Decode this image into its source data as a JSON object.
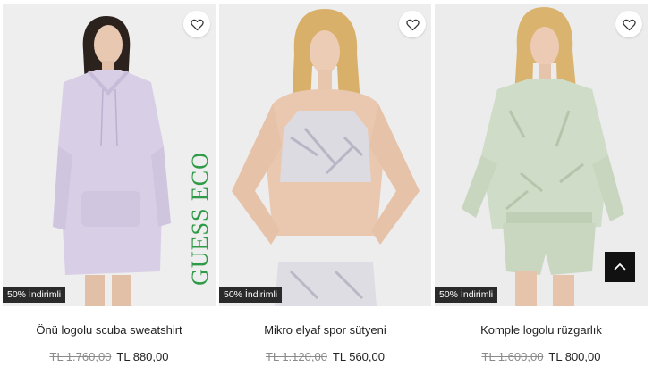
{
  "products": [
    {
      "name": "Önü logolu scuba sweatshirt",
      "old_price": "TL 1.760,00",
      "new_price": "TL 880,00",
      "badge": "50% İndirimli",
      "brand_mark": "GUESS ECO"
    },
    {
      "name": "Mikro elyaf spor sütyeni",
      "old_price": "TL 1.120,00",
      "new_price": "TL 560,00",
      "badge": "50% İndirimli"
    },
    {
      "name": "Komple logolu rüzgarlık",
      "old_price": "TL 1.600,00",
      "new_price": "TL 800,00",
      "badge": "50% İndirimli"
    }
  ],
  "icons": {
    "wishlist": "heart-icon",
    "back_to_top": "chevron-up-icon"
  },
  "colors": {
    "badge_bg": "#2a2a2a",
    "eco_green": "#2f9a47",
    "old_price": "#8a8a8a",
    "back_to_top_bg": "#111111"
  }
}
